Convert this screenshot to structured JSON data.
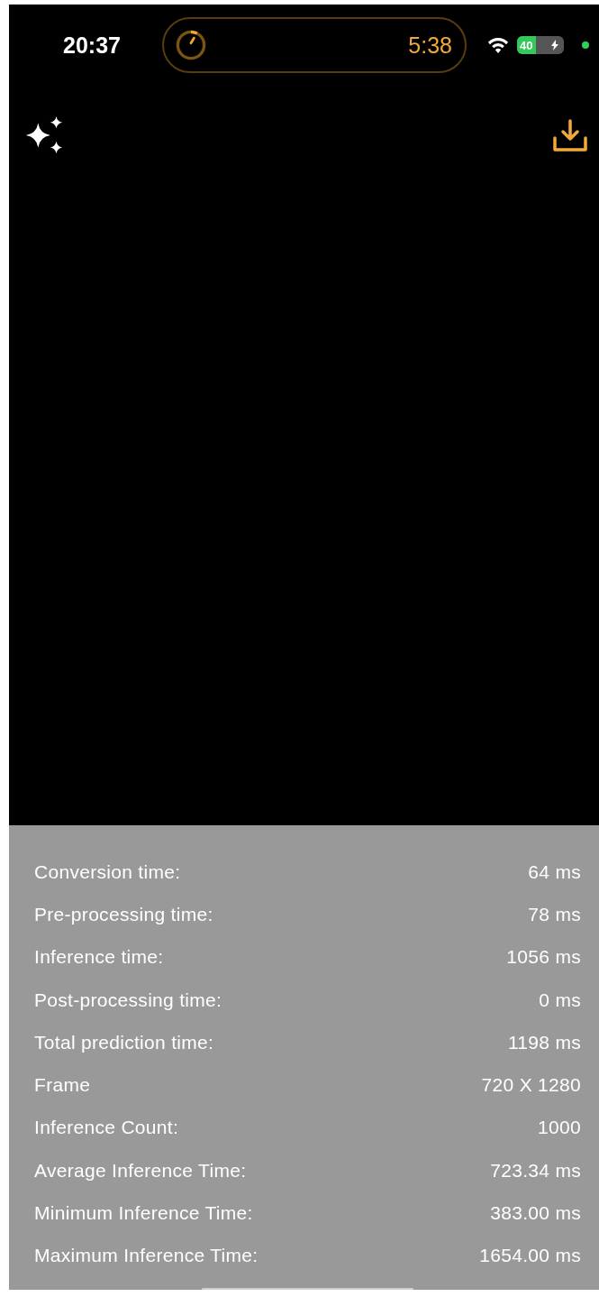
{
  "status_bar": {
    "time": "20:37",
    "timer": "5:38",
    "battery": {
      "text": "40",
      "level": 0.4
    }
  },
  "stats": [
    {
      "label": "Conversion time:",
      "value": "64 ms"
    },
    {
      "label": "Pre-processing time:",
      "value": "78 ms"
    },
    {
      "label": "Inference time:",
      "value": "1056 ms"
    },
    {
      "label": "Post-processing time:",
      "value": "0 ms"
    },
    {
      "label": "Total prediction time:",
      "value": "1198 ms"
    },
    {
      "label": "Frame",
      "value": "720 X 1280"
    },
    {
      "label": "Inference Count:",
      "value": "1000"
    },
    {
      "label": "Average Inference Time:",
      "value": "723.34 ms"
    },
    {
      "label": "Minimum Inference Time:",
      "value": "383.00 ms"
    },
    {
      "label": "Maximum Inference Time:",
      "value": "1654.00 ms"
    }
  ]
}
